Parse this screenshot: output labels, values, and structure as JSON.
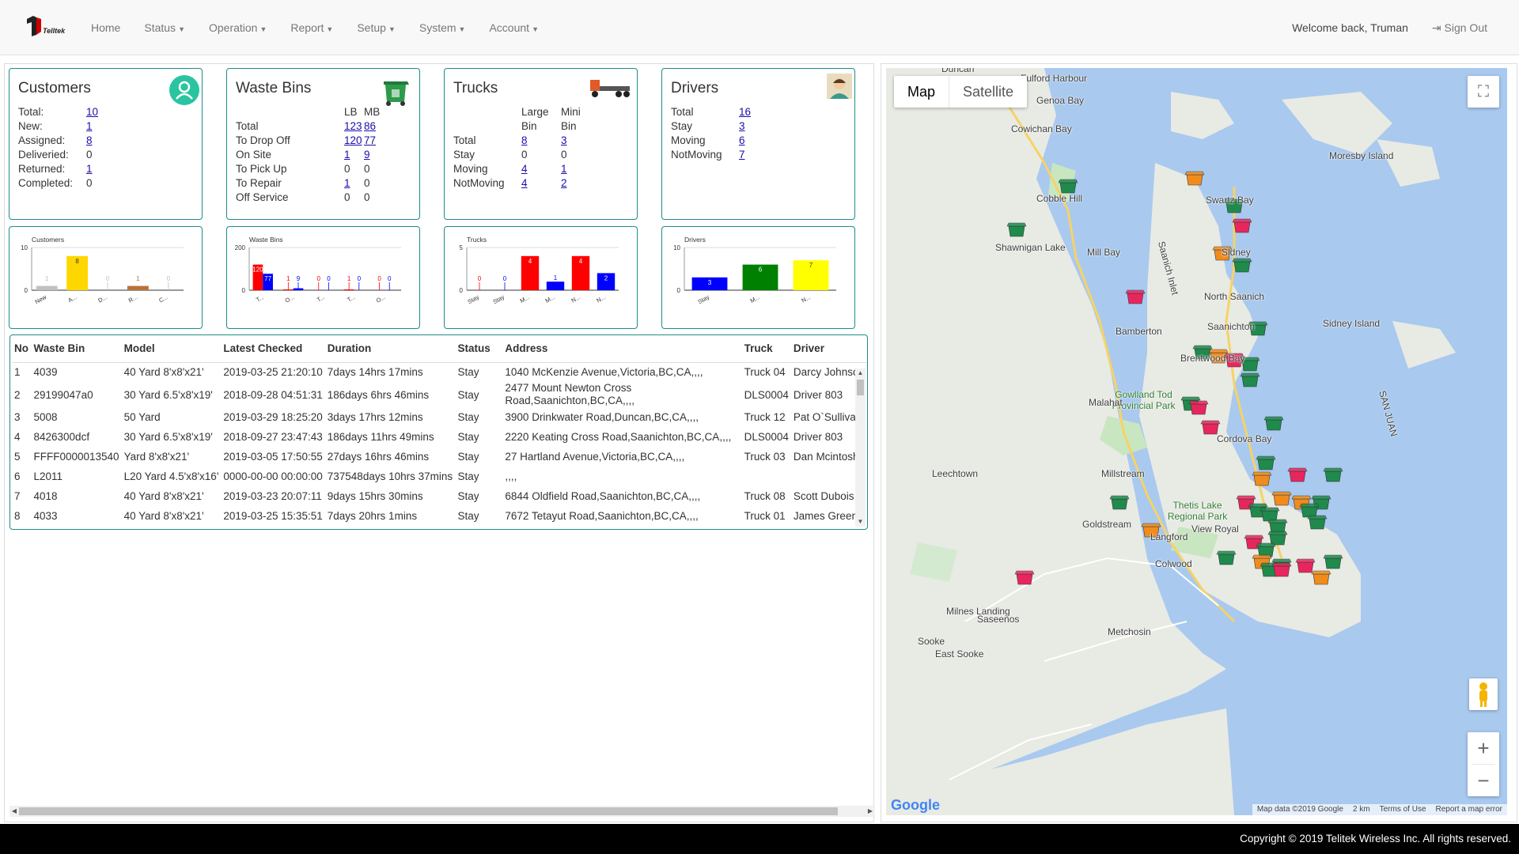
{
  "nav": {
    "brand": "Telltek",
    "items": [
      "Home",
      "Status",
      "Operation",
      "Report",
      "Setup",
      "System",
      "Account"
    ],
    "dropdown_flags": [
      false,
      true,
      true,
      true,
      true,
      true,
      true
    ],
    "welcome": "Welcome back, Truman",
    "signout": "Sign Out"
  },
  "customers": {
    "title": "Customers",
    "rows": [
      {
        "label": "Total:",
        "value": "10",
        "link": true
      },
      {
        "label": "New:",
        "value": "1",
        "link": true
      },
      {
        "label": "Assigned:",
        "value": "8",
        "link": true
      },
      {
        "label": "Deliveried:",
        "value": "0",
        "link": false
      },
      {
        "label": "Returned:",
        "value": "1",
        "link": true
      },
      {
        "label": "Completed:",
        "value": "0",
        "link": false
      }
    ]
  },
  "waste_bins": {
    "title": "Waste Bins",
    "col_lb": "LB",
    "col_mb": "MB",
    "rows": [
      {
        "label": "Total",
        "lb": "123",
        "mb": "86"
      },
      {
        "label": "To Drop Off",
        "lb": "120",
        "mb": "77"
      },
      {
        "label": "On Site",
        "lb": "1",
        "mb": "9"
      },
      {
        "label": "To Pick Up",
        "lb": "0",
        "mb": "0"
      },
      {
        "label": "To Repair",
        "lb": "1",
        "mb": "0"
      },
      {
        "label": "Off Service",
        "lb": "0",
        "mb": "0"
      }
    ]
  },
  "trucks": {
    "title": "Trucks",
    "col_large_1": "Large",
    "col_large_2": "Bin",
    "col_mini_1": "Mini",
    "col_mini_2": "Bin",
    "rows": [
      {
        "label": "Total",
        "large": "8",
        "mini": "3"
      },
      {
        "label": "Stay",
        "large": "0",
        "mini": "0"
      },
      {
        "label": "Moving",
        "large": "4",
        "mini": "1"
      },
      {
        "label": "NotMoving",
        "large": "4",
        "mini": "2"
      }
    ]
  },
  "drivers": {
    "title": "Drivers",
    "rows": [
      {
        "label": "Total",
        "value": "16"
      },
      {
        "label": "Stay",
        "value": "3"
      },
      {
        "label": "Moving",
        "value": "6"
      },
      {
        "label": "NotMoving",
        "value": "7"
      }
    ]
  },
  "chart_data": [
    {
      "type": "bar",
      "title": "Customers",
      "ylim": [
        0,
        10
      ],
      "yticks": [
        0,
        10
      ],
      "categories": [
        "New",
        "A...",
        "D...",
        "R...",
        "C..."
      ],
      "values": [
        1,
        8,
        0,
        1,
        0
      ],
      "colors": [
        "#c0c0c0",
        "#ffd700",
        "#c0c0c0",
        "#b8733b",
        "#c0c0c0"
      ]
    },
    {
      "type": "bar",
      "title": "Waste Bins",
      "ylim": [
        0,
        200
      ],
      "yticks": [
        0,
        200
      ],
      "categories": [
        "T...",
        "O...",
        "T...",
        "T...",
        "O..."
      ],
      "series": [
        {
          "values": [
            120,
            1,
            0,
            1,
            0
          ],
          "colors": [
            "#ff0000",
            "#ff0000",
            "#ff0000",
            "#ff0000",
            "#ff0000"
          ]
        },
        {
          "values": [
            77,
            9,
            0,
            0,
            0
          ],
          "colors": [
            "#0000ff",
            "#0000ff",
            "#0000ff",
            "#0000ff",
            "#0000ff"
          ]
        }
      ]
    },
    {
      "type": "bar",
      "title": "Trucks",
      "ylim": [
        0,
        5
      ],
      "yticks": [
        0,
        5
      ],
      "categories": [
        "Stay",
        "Stay",
        "M...",
        "M...",
        "N...",
        "N..."
      ],
      "values": [
        0,
        0,
        4,
        1,
        4,
        2
      ],
      "colors": [
        "#ff0000",
        "#0000ff",
        "#ff0000",
        "#0000ff",
        "#ff0000",
        "#0000ff"
      ]
    },
    {
      "type": "bar",
      "title": "Drivers",
      "ylim": [
        0,
        10
      ],
      "yticks": [
        0,
        10
      ],
      "categories": [
        "Stay",
        "M...",
        "N..."
      ],
      "values": [
        3,
        6,
        7
      ],
      "colors": [
        "#0000ff",
        "#008000",
        "#ffff00"
      ]
    }
  ],
  "table": {
    "headers": [
      "No",
      "Waste Bin",
      "Model",
      "Latest Checked",
      "Duration",
      "Status",
      "Address",
      "Truck",
      "Driver"
    ],
    "rows": [
      [
        "1",
        "4039",
        "40 Yard 8'x8'x21'",
        "2019-03-25 21:20:10",
        "7days 14hrs 17mins",
        "Stay",
        "1040 McKenzie Avenue,Victoria,BC,CA,,,,",
        "Truck 04",
        "Darcy Johnson"
      ],
      [
        "2",
        "29199047a0",
        "30 Yard 6.5'x8'x19'",
        "2018-09-28 04:51:31",
        "186days 6hrs 46mins",
        "Stay",
        "2477 Mount Newton Cross Road,Saanichton,BC,CA,,,,",
        "DLS0004",
        "Driver 803"
      ],
      [
        "3",
        "5008",
        "50 Yard",
        "2019-03-29 18:25:20",
        "3days 17hrs 12mins",
        "Stay",
        "3900 Drinkwater Road,Duncan,BC,CA,,,,",
        "Truck 12",
        "Pat O`Sullivan"
      ],
      [
        "4",
        "8426300dcf",
        "30 Yard 6.5'x8'x19'",
        "2018-09-27 23:47:43",
        "186days 11hrs 49mins",
        "Stay",
        "2220 Keating Cross Road,Saanichton,BC,CA,,,,",
        "DLS0004",
        "Driver 803"
      ],
      [
        "5",
        "FFFF0000013540",
        "Yard 8'x8'x21'",
        "2019-03-05 17:50:55",
        "27days 16hrs 46mins",
        "Stay",
        "27 Hartland Avenue,Victoria,BC,CA,,,,",
        "Truck 03",
        "Dan Mcintosh"
      ],
      [
        "6",
        "L2011",
        "L20 Yard 4.5'x8'x16'",
        "0000-00-00 00:00:00",
        "737548days 10hrs 37mins",
        "Stay",
        ",,,,",
        "",
        ""
      ],
      [
        "7",
        "4018",
        "40 Yard 8'x8'x21'",
        "2019-03-23 20:07:11",
        "9days 15hrs 30mins",
        "Stay",
        "6844 Oldfield Road,Saanichton,BC,CA,,,,",
        "Truck 08",
        "Scott Dubois"
      ],
      [
        "8",
        "4033",
        "40 Yard 8'x8'x21'",
        "2019-03-25 15:35:51",
        "7days 20hrs 1mins",
        "Stay",
        "7672 Tetayut Road,Saanichton,BC,CA,,,,",
        "Truck 01",
        "James Green"
      ]
    ]
  },
  "map": {
    "type_map": "Map",
    "type_satellite": "Satellite",
    "google": "Google",
    "footer": [
      "Map data ©2019 Google",
      "2 km",
      "Terms of Use",
      "Report a map error"
    ],
    "places": [
      "Duncan",
      "Fulford Harbour",
      "Genoa Bay",
      "Cowichan Bay",
      "Moresby Island",
      "Cobble Hill",
      "Swartz Bay",
      "Shawnigan Lake",
      "Mill Bay",
      "Sidney",
      "Saanich Inlet",
      "North Saanich",
      "Sidney Island",
      "Bamberton",
      "Saanichton",
      "Brentwood Bay",
      "Gowlland Tod Provincial Park",
      "Malahat",
      "Cordova Bay",
      "Leechtown",
      "Millstream",
      "Thetis Lake Regional Park",
      "Goldstream",
      "Langford",
      "View Royal",
      "Colwood",
      "Milnes Landing",
      "Saseenos",
      "Metchosin",
      "Sooke",
      "East Sooke",
      "SAN JUAN"
    ],
    "colors": {
      "land": "#e8eae4",
      "water": "#a9c9ef",
      "park": "#c8e6c0",
      "road": "#f6d365",
      "bin_green": "#1f8a4c",
      "bin_orange": "#f08c1c",
      "bin_red": "#e8265e"
    }
  },
  "footer": "Copyright © 2019 Telitek Wireless Inc. All rights reserved."
}
